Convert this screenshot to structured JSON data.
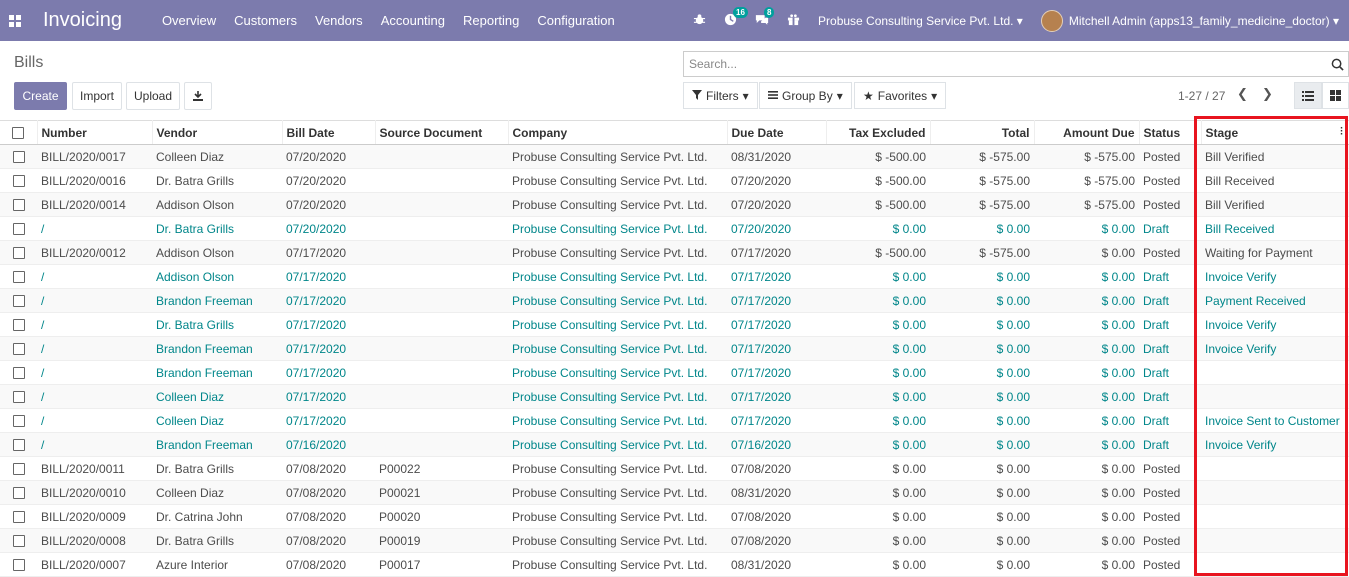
{
  "app": {
    "title": "Invoicing",
    "menu": [
      "Overview",
      "Customers",
      "Vendors",
      "Accounting",
      "Reporting",
      "Configuration"
    ],
    "activity_count": "16",
    "message_count": "8",
    "company": "Probuse Consulting Service Pvt. Ltd.",
    "user": "Mitchell Admin (apps13_family_medicine_doctor)"
  },
  "page": {
    "title": "Bills",
    "create_label": "Create",
    "import_label": "Import",
    "upload_label": "Upload",
    "search_placeholder": "Search...",
    "filters_label": "Filters",
    "groupby_label": "Group By",
    "favorites_label": "Favorites",
    "pager": "1-27 / 27"
  },
  "table": {
    "headers": [
      "Number",
      "Vendor",
      "Bill Date",
      "Source Document",
      "Company",
      "Due Date",
      "Tax Excluded",
      "Total",
      "Amount Due",
      "Status",
      "Stage"
    ],
    "rows": [
      {
        "number": "BILL/2020/0017",
        "vendor": "Colleen Diaz",
        "bill_date": "07/20/2020",
        "source": "",
        "company": "Probuse Consulting Service Pvt. Ltd.",
        "due_date": "08/31/2020",
        "tax_excl": "$ -500.00",
        "total": "$ -575.00",
        "amount_due": "$ -575.00",
        "status": "Posted",
        "stage": "Bill Verified"
      },
      {
        "number": "BILL/2020/0016",
        "vendor": "Dr. Batra Grills",
        "bill_date": "07/20/2020",
        "source": "",
        "company": "Probuse Consulting Service Pvt. Ltd.",
        "due_date": "07/20/2020",
        "tax_excl": "$ -500.00",
        "total": "$ -575.00",
        "amount_due": "$ -575.00",
        "status": "Posted",
        "stage": "Bill Received"
      },
      {
        "number": "BILL/2020/0014",
        "vendor": "Addison Olson",
        "bill_date": "07/20/2020",
        "source": "",
        "company": "Probuse Consulting Service Pvt. Ltd.",
        "due_date": "07/20/2020",
        "tax_excl": "$ -500.00",
        "total": "$ -575.00",
        "amount_due": "$ -575.00",
        "status": "Posted",
        "stage": "Bill Verified"
      },
      {
        "number": "/",
        "vendor": "Dr. Batra Grills",
        "bill_date": "07/20/2020",
        "source": "",
        "company": "Probuse Consulting Service Pvt. Ltd.",
        "due_date": "07/20/2020",
        "tax_excl": "$ 0.00",
        "total": "$ 0.00",
        "amount_due": "$ 0.00",
        "status": "Draft",
        "stage": "Bill Received"
      },
      {
        "number": "BILL/2020/0012",
        "vendor": "Addison Olson",
        "bill_date": "07/17/2020",
        "source": "",
        "company": "Probuse Consulting Service Pvt. Ltd.",
        "due_date": "07/17/2020",
        "tax_excl": "$ -500.00",
        "total": "$ -575.00",
        "amount_due": "$ 0.00",
        "status": "Posted",
        "stage": "Waiting for Payment"
      },
      {
        "number": "/",
        "vendor": "Addison Olson",
        "bill_date": "07/17/2020",
        "source": "",
        "company": "Probuse Consulting Service Pvt. Ltd.",
        "due_date": "07/17/2020",
        "tax_excl": "$ 0.00",
        "total": "$ 0.00",
        "amount_due": "$ 0.00",
        "status": "Draft",
        "stage": "Invoice Verify"
      },
      {
        "number": "/",
        "vendor": "Brandon Freeman",
        "bill_date": "07/17/2020",
        "source": "",
        "company": "Probuse Consulting Service Pvt. Ltd.",
        "due_date": "07/17/2020",
        "tax_excl": "$ 0.00",
        "total": "$ 0.00",
        "amount_due": "$ 0.00",
        "status": "Draft",
        "stage": "Payment Received"
      },
      {
        "number": "/",
        "vendor": "Dr. Batra Grills",
        "bill_date": "07/17/2020",
        "source": "",
        "company": "Probuse Consulting Service Pvt. Ltd.",
        "due_date": "07/17/2020",
        "tax_excl": "$ 0.00",
        "total": "$ 0.00",
        "amount_due": "$ 0.00",
        "status": "Draft",
        "stage": "Invoice Verify"
      },
      {
        "number": "/",
        "vendor": "Brandon Freeman",
        "bill_date": "07/17/2020",
        "source": "",
        "company": "Probuse Consulting Service Pvt. Ltd.",
        "due_date": "07/17/2020",
        "tax_excl": "$ 0.00",
        "total": "$ 0.00",
        "amount_due": "$ 0.00",
        "status": "Draft",
        "stage": "Invoice Verify"
      },
      {
        "number": "/",
        "vendor": "Brandon Freeman",
        "bill_date": "07/17/2020",
        "source": "",
        "company": "Probuse Consulting Service Pvt. Ltd.",
        "due_date": "07/17/2020",
        "tax_excl": "$ 0.00",
        "total": "$ 0.00",
        "amount_due": "$ 0.00",
        "status": "Draft",
        "stage": ""
      },
      {
        "number": "/",
        "vendor": "Colleen Diaz",
        "bill_date": "07/17/2020",
        "source": "",
        "company": "Probuse Consulting Service Pvt. Ltd.",
        "due_date": "07/17/2020",
        "tax_excl": "$ 0.00",
        "total": "$ 0.00",
        "amount_due": "$ 0.00",
        "status": "Draft",
        "stage": ""
      },
      {
        "number": "/",
        "vendor": "Colleen Diaz",
        "bill_date": "07/17/2020",
        "source": "",
        "company": "Probuse Consulting Service Pvt. Ltd.",
        "due_date": "07/17/2020",
        "tax_excl": "$ 0.00",
        "total": "$ 0.00",
        "amount_due": "$ 0.00",
        "status": "Draft",
        "stage": "Invoice Sent to Customer"
      },
      {
        "number": "/",
        "vendor": "Brandon Freeman",
        "bill_date": "07/16/2020",
        "source": "",
        "company": "Probuse Consulting Service Pvt. Ltd.",
        "due_date": "07/16/2020",
        "tax_excl": "$ 0.00",
        "total": "$ 0.00",
        "amount_due": "$ 0.00",
        "status": "Draft",
        "stage": "Invoice Verify"
      },
      {
        "number": "BILL/2020/0011",
        "vendor": "Dr. Batra Grills",
        "bill_date": "07/08/2020",
        "source": "P00022",
        "company": "Probuse Consulting Service Pvt. Ltd.",
        "due_date": "07/08/2020",
        "tax_excl": "$ 0.00",
        "total": "$ 0.00",
        "amount_due": "$ 0.00",
        "status": "Posted",
        "stage": ""
      },
      {
        "number": "BILL/2020/0010",
        "vendor": "Colleen Diaz",
        "bill_date": "07/08/2020",
        "source": "P00021",
        "company": "Probuse Consulting Service Pvt. Ltd.",
        "due_date": "08/31/2020",
        "tax_excl": "$ 0.00",
        "total": "$ 0.00",
        "amount_due": "$ 0.00",
        "status": "Posted",
        "stage": ""
      },
      {
        "number": "BILL/2020/0009",
        "vendor": "Dr. Catrina John",
        "bill_date": "07/08/2020",
        "source": "P00020",
        "company": "Probuse Consulting Service Pvt. Ltd.",
        "due_date": "07/08/2020",
        "tax_excl": "$ 0.00",
        "total": "$ 0.00",
        "amount_due": "$ 0.00",
        "status": "Posted",
        "stage": ""
      },
      {
        "number": "BILL/2020/0008",
        "vendor": "Dr. Batra Grills",
        "bill_date": "07/08/2020",
        "source": "P00019",
        "company": "Probuse Consulting Service Pvt. Ltd.",
        "due_date": "07/08/2020",
        "tax_excl": "$ 0.00",
        "total": "$ 0.00",
        "amount_due": "$ 0.00",
        "status": "Posted",
        "stage": ""
      },
      {
        "number": "BILL/2020/0007",
        "vendor": "Azure Interior",
        "bill_date": "07/08/2020",
        "source": "P00017",
        "company": "Probuse Consulting Service Pvt. Ltd.",
        "due_date": "08/31/2020",
        "tax_excl": "$ 0.00",
        "total": "$ 0.00",
        "amount_due": "$ 0.00",
        "status": "Posted",
        "stage": ""
      }
    ]
  },
  "colors": {
    "navbar": "#7c7bad",
    "draft_text": "#00868a",
    "highlight": "#e8141f"
  }
}
